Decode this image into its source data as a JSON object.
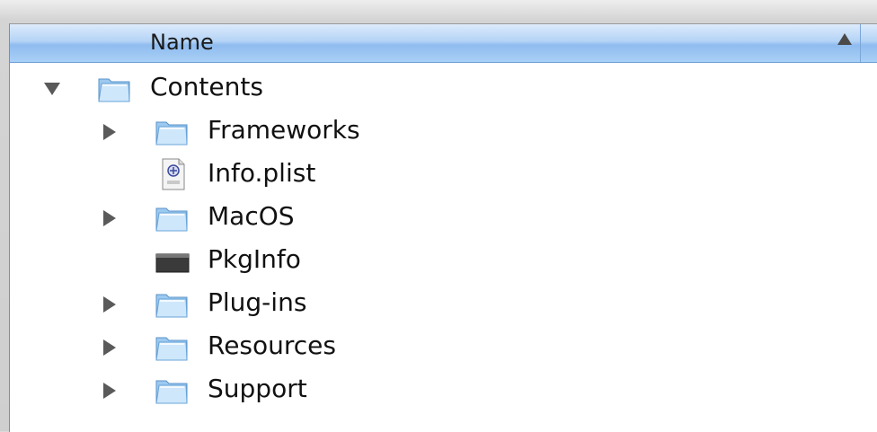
{
  "header": {
    "column_name": "Name",
    "sort_direction": "ascending"
  },
  "rows": [
    {
      "label": "Contents",
      "kind": "folder",
      "icon": "folder-icon",
      "level": 0,
      "disclosure": "expanded"
    },
    {
      "label": "Frameworks",
      "kind": "folder",
      "icon": "folder-icon",
      "level": 1,
      "disclosure": "collapsed"
    },
    {
      "label": "Info.plist",
      "kind": "plist",
      "icon": "plist-file-icon",
      "level": 1,
      "disclosure": "none"
    },
    {
      "label": "MacOS",
      "kind": "folder",
      "icon": "folder-icon",
      "level": 1,
      "disclosure": "collapsed"
    },
    {
      "label": "PkgInfo",
      "kind": "file",
      "icon": "executable-file-icon",
      "level": 1,
      "disclosure": "none"
    },
    {
      "label": "Plug-ins",
      "kind": "folder",
      "icon": "folder-icon",
      "level": 1,
      "disclosure": "collapsed"
    },
    {
      "label": "Resources",
      "kind": "folder",
      "icon": "folder-icon",
      "level": 1,
      "disclosure": "collapsed"
    },
    {
      "label": "Support",
      "kind": "folder",
      "icon": "folder-icon",
      "level": 1,
      "disclosure": "collapsed"
    }
  ],
  "colors": {
    "header_top": "#dcebfb",
    "header_bottom": "#8fbcef",
    "folder_light": "#d6ecfb",
    "folder_dark": "#6fb0e4"
  }
}
